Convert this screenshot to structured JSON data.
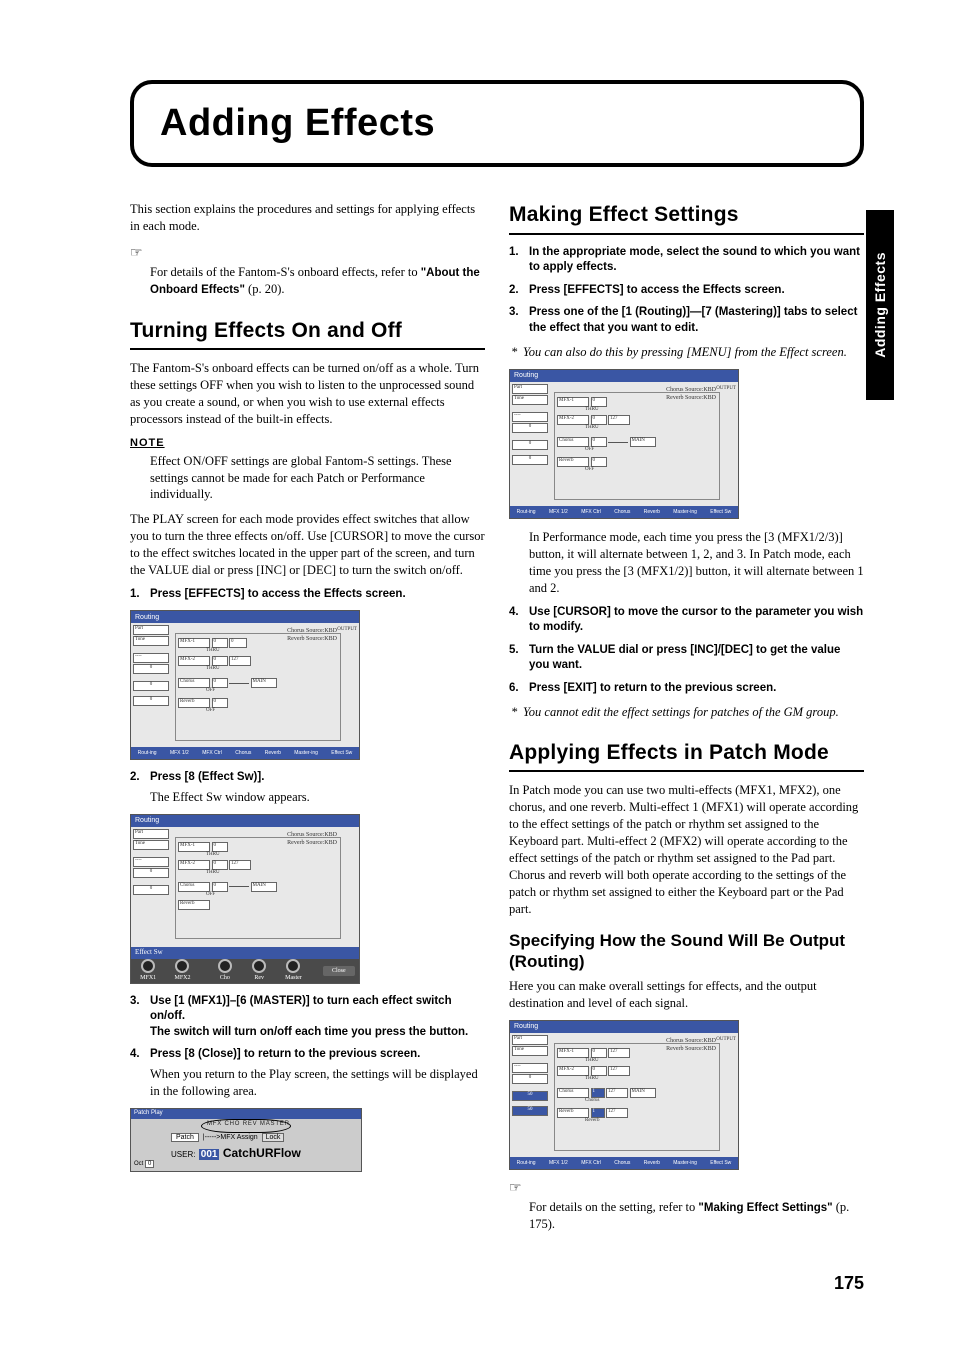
{
  "side_tab": "Adding Effects",
  "banner": "Adding Effects",
  "intro": "This section explains the procedures and settings for applying effects in each mode.",
  "ref1_a": "For details of the Fantom-S's onboard effects, refer to ",
  "ref1_b": "\"About the Onboard Effects\"",
  "ref1_c": " (p. 20).",
  "sec1_title": "Turning Effects On and Off",
  "sec1_p1": "The Fantom-S's onboard effects can be turned on/off as a whole. Turn these settings OFF when you wish to listen to the unprocessed sound as you create a sound, or when you wish to use external effects processors instead of the built-in effects.",
  "note_label": "NOTE",
  "sec1_note": "Effect ON/OFF settings are global Fantom-S settings. These settings cannot be made for each Patch or Performance individually.",
  "sec1_p2": "The PLAY screen for each mode provides effect switches that allow you to turn the three effects on/off. Use [CURSOR] to move the cursor to the effect switches located in the upper part of the screen, and turn the VALUE dial or press [INC] or [DEC] to turn the switch on/off.",
  "left_steps": {
    "s1": "Press [EFFECTS] to access the Effects screen.",
    "s2": "Press [8 (Effect Sw)].",
    "s2_body": "The Effect Sw window appears.",
    "s3a": "Use [1 (MFX1)]–[6 (MASTER)] to turn each effect switch on/off.",
    "s3b": "The switch will turn on/off each time you press the button.",
    "s4": "Press [8 (Close)] to return to the previous screen.",
    "s4_body": "When you return to the Play screen, the settings will be displayed in the following area."
  },
  "sec2_title": "Making Effect Settings",
  "right_steps": {
    "s1": "In the appropriate mode, select the sound to which you want to apply effects.",
    "s2": "Press [EFFECTS] to access the Effects screen.",
    "s3": "Press one of the [1 (Routing)]—[7 (Mastering)] tabs to select the effect that you want to edit.",
    "s3_star": "You can also do this by pressing [MENU] from the Effect screen.",
    "after_img": "In Performance mode, each time you press the [3 (MFX1/2/3)] button, it will alternate between 1, 2, and 3. In Patch mode, each time you press the [3 (MFX1/2)] button, it will alternate between 1 and 2.",
    "s4": "Use [CURSOR] to move the cursor to the parameter you wish to modify.",
    "s5": "Turn the VALUE dial or press [INC]/[DEC] to get the value you want.",
    "s6": "Press [EXIT] to return to the previous screen.",
    "s6_star": "You cannot edit the effect settings for patches of the GM group."
  },
  "sec3_title": "Applying Effects in Patch Mode",
  "sec3_p1": "In Patch mode you can use two multi-effects (MFX1, MFX2), one chorus, and one reverb. Multi-effect 1 (MFX1) will operate according to the effect settings of the patch or rhythm set assigned to the Keyboard part. Multi-effect 2 (MFX2) will operate according to the effect settings of the patch or rhythm set assigned to the Pad part. Chorus and reverb will both operate according to the settings of the patch or rhythm set assigned to either the Keyboard part or the Pad part.",
  "sub1_title": "Specifying How the Sound Will Be Output (Routing)",
  "sub1_p1": "Here you can make overall settings for effects, and the output destination and level of each signal.",
  "ref2_a": "For details on the setting, refer to ",
  "ref2_b": "\"Making Effect Settings\"",
  "ref2_c": " (p. 175).",
  "page_number": "175",
  "scr": {
    "routing": "Routing",
    "part": "Part",
    "kbd": "KBD",
    "tone": "Tone",
    "chorus_src": "Chorus Source:KBD",
    "reverb_src": "Reverb Source:KBD",
    "output": "OUTPUT",
    "mfx1": "MFX-1",
    "mfx2": "MFX-2",
    "thru": "THRU",
    "chorus": "Chorus",
    "off": "OFF",
    "reverb": "Reverb",
    "main": "MAIN",
    "f_routing": "Rout-ing",
    "f_mfx12": "MFX 1/2",
    "f_mfxctrl": "MFX Ctrl",
    "f_chorus": "Chorus",
    "f_reverb": "Reverb",
    "f_master": "Master-ing",
    "f_effectsw": "Effect Sw",
    "effectsw": "Effect Sw",
    "mfx1s": "MFX1",
    "mfx2s": "MFX2",
    "cho": "Cho",
    "rev": "Rev",
    "master": "Master",
    "close": "Close",
    "patchplay": "Patch Play",
    "mfx_list": "MFX  CHO  REV  MASTER",
    "patch": "Patch",
    "mfx_assign": "|----->MFX Assign",
    "lock": "Lock",
    "user_pre": "USER:",
    "user_num": "001",
    "patchname": "CatchURFlow",
    "oct": "Oct",
    "zero": "0",
    "val127": "127"
  }
}
